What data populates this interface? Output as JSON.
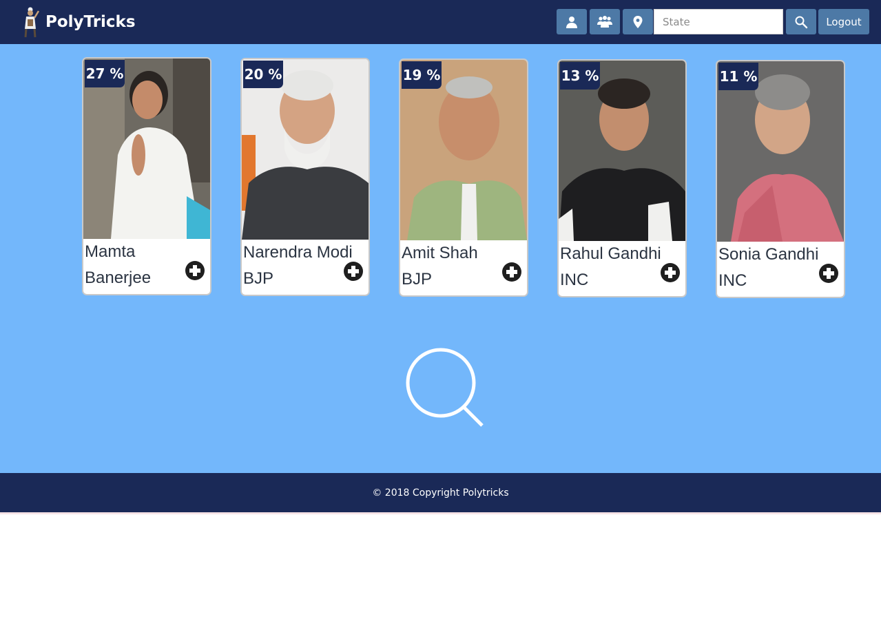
{
  "app": {
    "title": "PolyTricks",
    "colors": {
      "navbar": "#1a2957",
      "accent_button": "#4d79a6",
      "main_bg": "#73b7fb",
      "footer": "#1a2957"
    }
  },
  "nav": {
    "buttons": [
      {
        "name": "user-button",
        "icon": "user-icon"
      },
      {
        "name": "group-button",
        "icon": "group-icon"
      },
      {
        "name": "location-button",
        "icon": "map-pin-icon"
      }
    ],
    "state_input": {
      "placeholder": "State",
      "value": ""
    },
    "search_button_icon": "search-icon",
    "logout_label": "Logout"
  },
  "candidates": [
    {
      "name": "Mamta Banerjee",
      "party": "",
      "percent": "27 %"
    },
    {
      "name": "Narendra Modi",
      "party": "BJP",
      "percent": "20 %"
    },
    {
      "name": "Amit Shah",
      "party": "BJP",
      "percent": "19 %"
    },
    {
      "name": "Rahul Gandhi",
      "party": "INC",
      "percent": "13 %"
    },
    {
      "name": "Sonia Gandhi",
      "party": "INC",
      "percent": "11 %"
    }
  ],
  "main": {
    "center_icon": "search-icon"
  },
  "footer": {
    "text": "© 2018 Copyright Polytricks"
  }
}
